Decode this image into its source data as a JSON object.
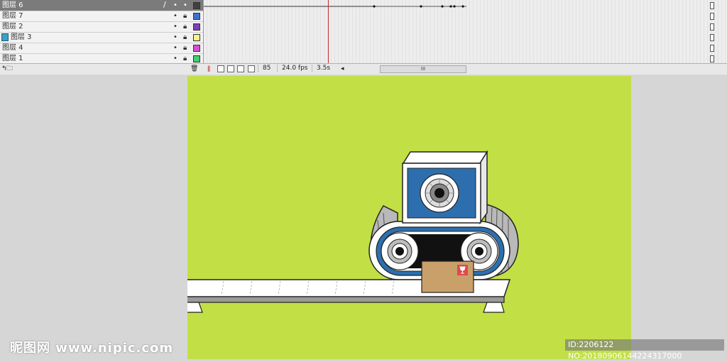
{
  "timeline": {
    "layers": [
      {
        "name": "图层 6",
        "selected": true,
        "color": "#404040"
      },
      {
        "name": "图层 7",
        "selected": false,
        "color": "#3f6fd1"
      },
      {
        "name": "图层 2",
        "selected": false,
        "color": "#7e3fb8"
      },
      {
        "name": "图层 3",
        "selected": false,
        "color": "#f7f38a"
      },
      {
        "name": "图层 4",
        "selected": false,
        "color": "#d54fd2"
      },
      {
        "name": "图层 1",
        "selected": false,
        "color": "#3fd16f"
      }
    ],
    "visibility_dot": "•",
    "current_frame": "85",
    "frame_rate": "24.0 fps",
    "elapsed_time": "3.5s",
    "scroll_grip": "III",
    "scroll_left_arrow": "◂"
  },
  "stage": {
    "background_color": "#c2df46"
  },
  "watermark": {
    "site_text": "昵图网 www.nipic.com",
    "id_text": "ID:2206122 NO:20180906144224317000"
  }
}
